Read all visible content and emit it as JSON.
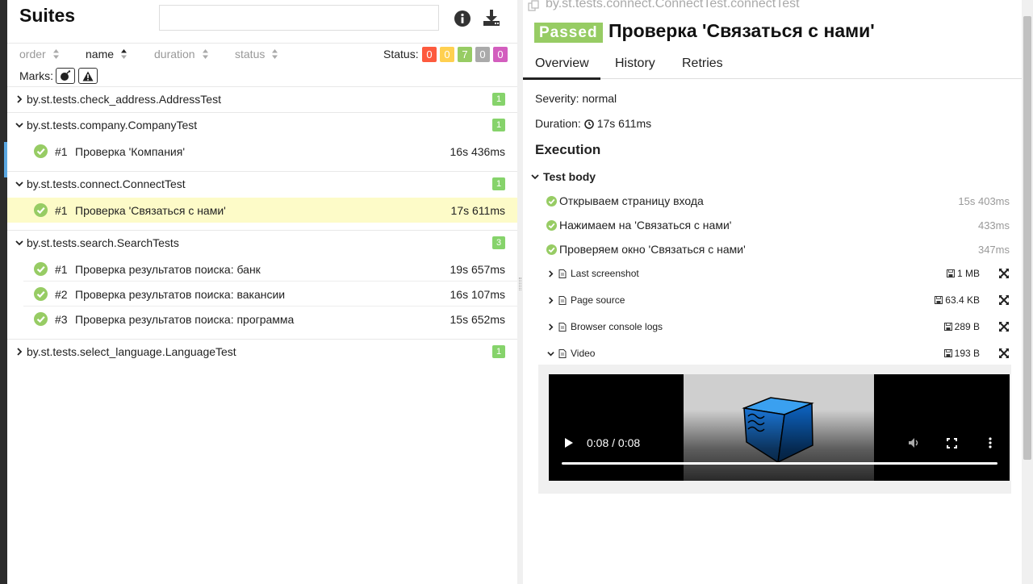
{
  "suites_panel": {
    "title": "Suites",
    "search": {
      "value": "",
      "placeholder": ""
    },
    "sort": {
      "order_label": "order",
      "name_label": "name",
      "duration_label": "duration",
      "status_label": "status"
    },
    "status_label": "Status:",
    "status_counts": [
      {
        "value": "0",
        "color": "#fd5a3e"
      },
      {
        "value": "0",
        "color": "#ffd050"
      },
      {
        "value": "7",
        "color": "#97cc64"
      },
      {
        "value": "0",
        "color": "#aaaaaa"
      },
      {
        "value": "0",
        "color": "#d35ebe"
      }
    ],
    "marks_label": "Marks:",
    "groups": [
      {
        "name": "by.st.tests.check_address.AddressTest",
        "count": "1",
        "expanded": false
      },
      {
        "name": "by.st.tests.company.CompanyTest",
        "count": "1",
        "expanded": true,
        "tests": [
          {
            "num": "#1",
            "title": "Проверка 'Компания'",
            "duration": "16s 436ms"
          }
        ]
      },
      {
        "name": "by.st.tests.connect.ConnectTest",
        "count": "1",
        "expanded": true,
        "tests": [
          {
            "num": "#1",
            "title": "Проверка 'Связаться с нами'",
            "duration": "17s 611ms",
            "selected": true
          }
        ]
      },
      {
        "name": "by.st.tests.search.SearchTests",
        "count": "3",
        "expanded": true,
        "tests": [
          {
            "num": "#1",
            "title": "Проверка результатов поиска: банк",
            "duration": "19s 657ms"
          },
          {
            "num": "#2",
            "title": "Проверка результатов поиска: вакансии",
            "duration": "16s 107ms"
          },
          {
            "num": "#3",
            "title": "Проверка результатов поиска: программа",
            "duration": "15s 652ms"
          }
        ]
      },
      {
        "name": "by.st.tests.select_language.LanguageTest",
        "count": "1",
        "expanded": false
      }
    ]
  },
  "detail_panel": {
    "test_path": "by.st.tests.connect.ConnectTest.connectTest",
    "status": "Passed",
    "status_color": "#97cc64",
    "title": "Проверка 'Связаться с нами'",
    "tabs": [
      "Overview",
      "History",
      "Retries"
    ],
    "severity": "Severity: normal",
    "duration_label": "Duration:",
    "duration_value": "17s 611ms",
    "execution_title": "Execution",
    "body_title": "Test body",
    "steps": [
      {
        "name": "Открываем страницу входа",
        "duration": "15s 403ms"
      },
      {
        "name": "Нажимаем на 'Связаться с нами'",
        "duration": "433ms"
      },
      {
        "name": "Проверяем окно 'Связаться с нами'",
        "duration": "347ms"
      }
    ],
    "attachments": [
      {
        "name": "Last screenshot",
        "size": "1 MB",
        "icon": "image-file-icon"
      },
      {
        "name": "Page source",
        "size": "63.4 KB",
        "icon": "text-file-icon"
      },
      {
        "name": "Browser console logs",
        "size": "289 B",
        "icon": "text-file-icon"
      },
      {
        "name": "Video",
        "size": "193 B",
        "icon": "video-file-icon"
      }
    ],
    "video": {
      "time": "0:08 / 0:08",
      "progress": 1.0
    }
  }
}
